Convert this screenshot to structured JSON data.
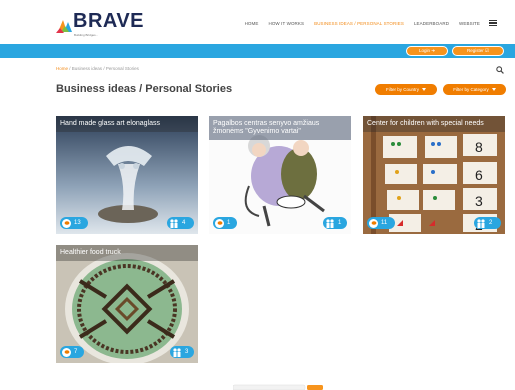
{
  "brand": {
    "name": "BRAVE",
    "tagline": "Building Bridges..."
  },
  "nav": {
    "items": [
      "HOME",
      "HOW IT WORKS",
      "BUSINESS IDEAS / PERSONAL STORIES",
      "LEADERBOARD",
      "WEBSITE"
    ],
    "active_index": 2
  },
  "auth": {
    "login": "Login ➜",
    "register": "Register ☑"
  },
  "breadcrumb": {
    "home": "Home",
    "sep": " / ",
    "ideas": "Business ideas",
    "current": "Personal Stories"
  },
  "page": {
    "title": "Business ideas / Personal Stories"
  },
  "filters": {
    "country": "Filter by Country",
    "category": "Filter by Category"
  },
  "cards": [
    {
      "title": "Hand made glass art elonaglass",
      "likes": "13",
      "helpers": "4"
    },
    {
      "title": "Pagalbos centras senyvo amžiaus žmonėms \"Gyvenimo vartai\"",
      "likes": "1",
      "helpers": "1"
    },
    {
      "title": "Center for children with special needs",
      "likes": "11",
      "helpers": "2"
    },
    {
      "title": "Healthier food truck",
      "likes": "7",
      "helpers": "3"
    }
  ],
  "colors": {
    "accent": "#f7941d",
    "bar": "#2aa6e0",
    "title": "#444444"
  }
}
